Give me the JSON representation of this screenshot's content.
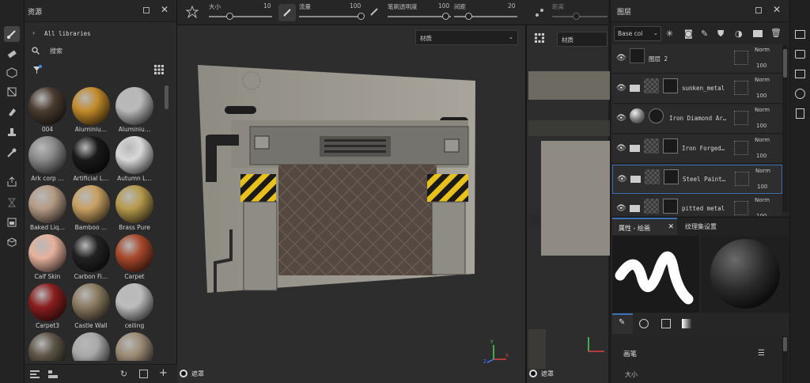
{
  "toolbar": {
    "size_label": "大小",
    "size_value": "10",
    "flow_label": "流量",
    "flow_value": "100",
    "stroke_opacity_label": "笔刷透明度",
    "stroke_opacity_value": "100",
    "spacing_label": "间距",
    "spacing_value": "20",
    "distance_label": "距离"
  },
  "assets": {
    "title": "资源",
    "all_libraries": "All libraries",
    "search_placeholder": "搜索",
    "materials": [
      {
        "label": "004",
        "color": "#4a3c30"
      },
      {
        "label": "Aluminiu…",
        "color": "#c28a2a"
      },
      {
        "label": "Aluminiu…",
        "color": "#b9b9b9"
      },
      {
        "label": "Ark corp …",
        "color": "#8a8a8a"
      },
      {
        "label": "Artificial L…",
        "color": "#1a1a1a"
      },
      {
        "label": "Autumn L…",
        "color": "#d8d8d8"
      },
      {
        "label": "Baked Liq…",
        "color": "#b49a84"
      },
      {
        "label": "Bamboo …",
        "color": "#c7a061"
      },
      {
        "label": "Brass Pure",
        "color": "#b69a4c"
      },
      {
        "label": "Calf Skin",
        "color": "#e6b19c"
      },
      {
        "label": "Carbon Fi…",
        "color": "#222222"
      },
      {
        "label": "Carpet",
        "color": "#a8482a"
      },
      {
        "label": "Carpet3",
        "color": "#8a1e1e"
      },
      {
        "label": "Castle Wall",
        "color": "#8a7a60"
      },
      {
        "label": "ceiling",
        "color": "#bcbcbc"
      },
      {
        "label": "",
        "color": "#5c5446"
      },
      {
        "label": "",
        "color": "#a8a8a8"
      },
      {
        "label": "",
        "color": "#9a8a74"
      }
    ]
  },
  "viewport": {
    "material_dropdown": "材质",
    "mask_label": "遮罩"
  },
  "uv_view": {
    "material_dropdown": "材质",
    "mask_label": "遮罩"
  },
  "layers": {
    "title": "图层",
    "channel_select": "Base col",
    "rows": [
      {
        "name": "图层 2",
        "blend": "Norm",
        "opacity": "100"
      },
      {
        "name": "sunken_metal",
        "blend": "Norm",
        "opacity": "100"
      },
      {
        "name": "Iron Diamond Ar…",
        "blend": "Norm",
        "opacity": "100"
      },
      {
        "name": "Iron Forged…",
        "blend": "Norm",
        "opacity": "100"
      },
      {
        "name": "Steel Paint…",
        "blend": "Norm",
        "opacity": "100"
      },
      {
        "name": "pitted metal",
        "blend": "Norm",
        "opacity": "100"
      }
    ]
  },
  "properties": {
    "tab_paint": "属性 - 绘画",
    "tab_texture_set": "纹理集设置",
    "brush_section": "画笔",
    "size_label": "大小"
  },
  "colors": {
    "accent": "#3d6fb5",
    "hazard_yellow": "#e8c21a"
  }
}
